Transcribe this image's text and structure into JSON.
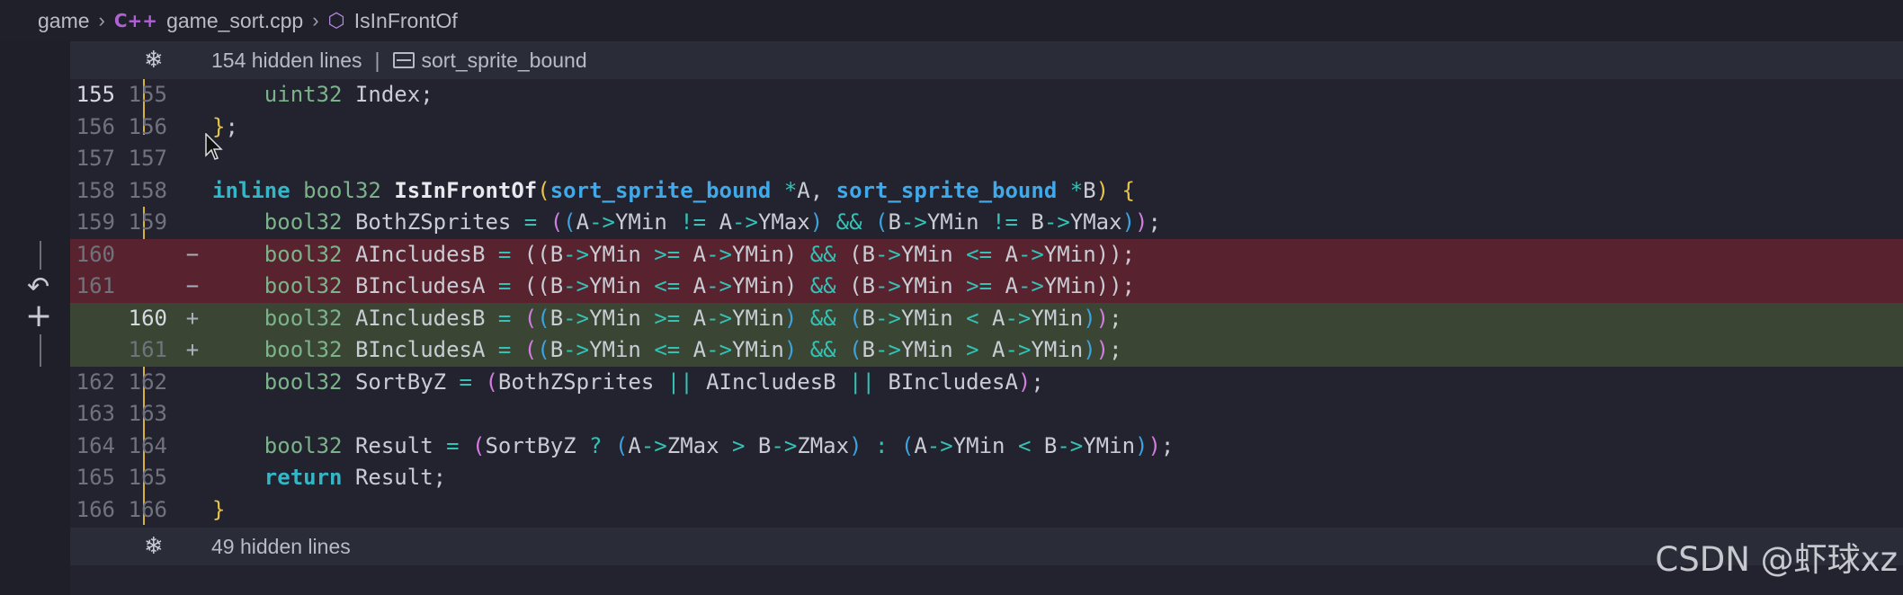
{
  "breadcrumb": {
    "folder": "game",
    "file": "game_sort.cpp",
    "file_icon": "C++",
    "symbol": "IsInFrontOf"
  },
  "folds": {
    "top_text": "154 hidden lines",
    "top_symbol": "sort_sprite_bound",
    "bottom_text": "49 hidden lines"
  },
  "line_numbers": {
    "l155o": "155",
    "l155n": "155",
    "l156o": "156",
    "l156n": "156",
    "l157o": "157",
    "l157n": "157",
    "l158o": "158",
    "l158n": "158",
    "l159o": "159",
    "l159n": "159",
    "l160o": "160",
    "l161o": "161",
    "l160n": "160",
    "l161n": "161",
    "l162o": "162",
    "l162n": "162",
    "l163o": "163",
    "l163n": "163",
    "l164o": "164",
    "l164n": "164",
    "l165o": "165",
    "l165n": "165",
    "l166o": "166",
    "l166n": "166"
  },
  "markers": {
    "minus": "−",
    "plus": "+"
  },
  "code": {
    "l155": "    uint32 Index;",
    "l156": "};",
    "l158": "inline bool32 IsInFrontOf(sort_sprite_bound *A, sort_sprite_bound *B) {",
    "l159": "    bool32 BothZSprites = ((A->YMin != A->YMax) && (B->YMin != B->YMax));",
    "l160_del": "    bool32 AIncludesB = ((B->YMin >= A->YMin) && (B->YMin <= A->YMin));",
    "l161_del": "    bool32 BIncludesA = ((B->YMin <= A->YMin) && (B->YMin >= A->YMin));",
    "l160_add": "    bool32 AIncludesB = ((B->YMin >= A->YMin) && (B->YMin < A->YMin));",
    "l161_add": "    bool32 BIncludesA = ((B->YMin <= A->YMin) && (B->YMin > A->YMin));",
    "l162": "    bool32 SortByZ = (BothZSprites || AIncludesB || BIncludesA);",
    "l164": "    bool32 Result = (SortByZ ? (A->ZMax > B->ZMax) : (A->YMin < B->YMin));",
    "l165": "    return Result;",
    "l166": "}"
  },
  "watermark": "CSDN @虾球xz",
  "colors": {
    "deleted_bg": "#58232e",
    "added_bg": "#3a4633",
    "keyword": "#35b6c7",
    "type": "#7cb38b",
    "class": "#3fa9ea"
  }
}
